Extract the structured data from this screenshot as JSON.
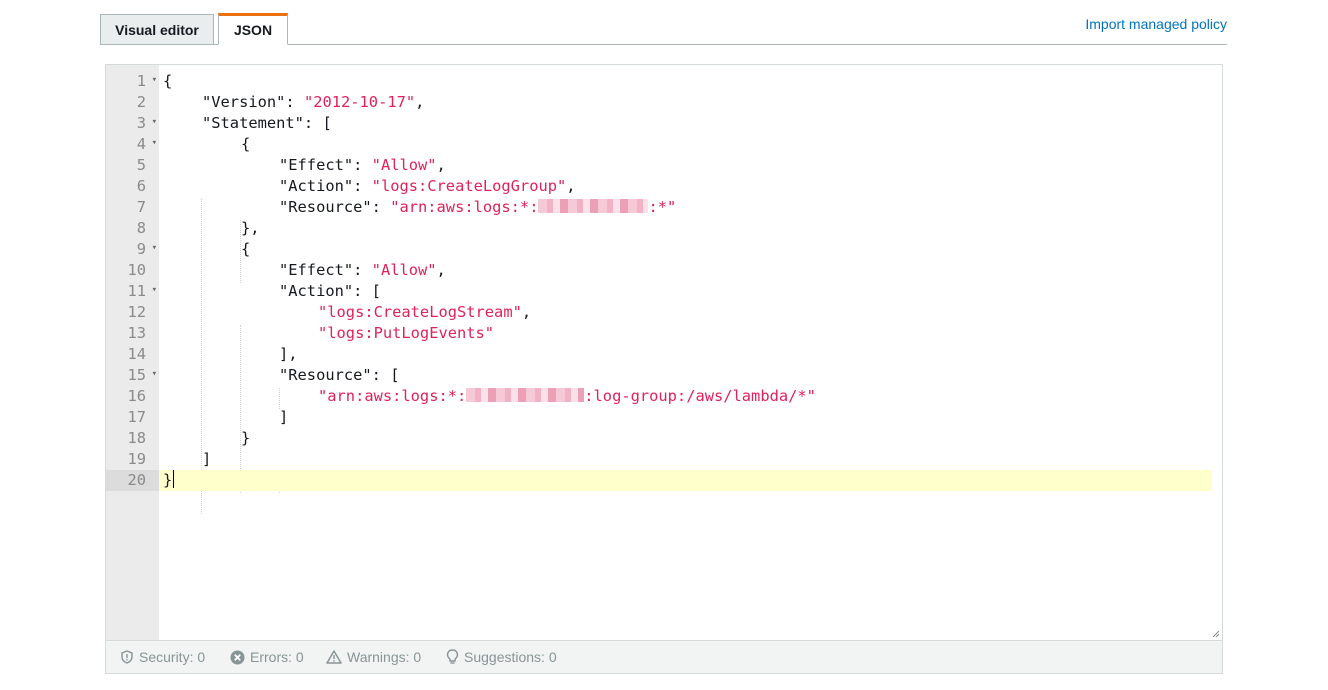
{
  "tabs": [
    {
      "label": "Visual editor",
      "active": false
    },
    {
      "label": "JSON",
      "active": true
    }
  ],
  "import_link": "Import managed policy",
  "editor": {
    "active_line": 20,
    "lines": [
      {
        "n": "1",
        "fold": true
      },
      {
        "n": "2",
        "fold": false
      },
      {
        "n": "3",
        "fold": true
      },
      {
        "n": "4",
        "fold": true
      },
      {
        "n": "5",
        "fold": false
      },
      {
        "n": "6",
        "fold": false
      },
      {
        "n": "7",
        "fold": false
      },
      {
        "n": "8",
        "fold": false
      },
      {
        "n": "9",
        "fold": true
      },
      {
        "n": "10",
        "fold": false
      },
      {
        "n": "11",
        "fold": true
      },
      {
        "n": "12",
        "fold": false
      },
      {
        "n": "13",
        "fold": false
      },
      {
        "n": "14",
        "fold": false
      },
      {
        "n": "15",
        "fold": true
      },
      {
        "n": "16",
        "fold": false
      },
      {
        "n": "17",
        "fold": false
      },
      {
        "n": "18",
        "fold": false
      },
      {
        "n": "19",
        "fold": false
      },
      {
        "n": "20",
        "fold": false
      }
    ],
    "code": {
      "l1": "{",
      "l2_key": "\"Version\": ",
      "l2_val": "\"2012-10-17\"",
      "l2_end": ",",
      "l3": "\"Statement\": [",
      "l4": "{",
      "l5_key": "\"Effect\": ",
      "l5_val": "\"Allow\"",
      "l5_end": ",",
      "l6_key": "\"Action\": ",
      "l6_val": "\"logs:CreateLogGroup\"",
      "l6_end": ",",
      "l7_key": "\"Resource\": ",
      "l7_val_a": "\"arn:aws:logs:*:",
      "l7_val_b": ":*\"",
      "l8": "},",
      "l9": "{",
      "l10_key": "\"Effect\": ",
      "l10_val": "\"Allow\"",
      "l10_end": ",",
      "l11": "\"Action\": [",
      "l12_val": "\"logs:CreateLogStream\"",
      "l12_end": ",",
      "l13_val": "\"logs:PutLogEvents\"",
      "l14": "],",
      "l15": "\"Resource\": [",
      "l16_val_a": "\"arn:aws:logs:*:",
      "l16_val_b": ":log-group:/aws/lambda/*\"",
      "l17": "]",
      "l18": "}",
      "l19": "]",
      "l20": "}"
    }
  },
  "status": {
    "security": "Security: 0",
    "errors": "Errors: 0",
    "warnings": "Warnings: 0",
    "suggestions": "Suggestions: 0"
  },
  "colors": {
    "string": "#e0225a",
    "active_tab_accent": "#ec7211",
    "link": "#0073bb",
    "active_line_bg": "#ffffcc"
  }
}
